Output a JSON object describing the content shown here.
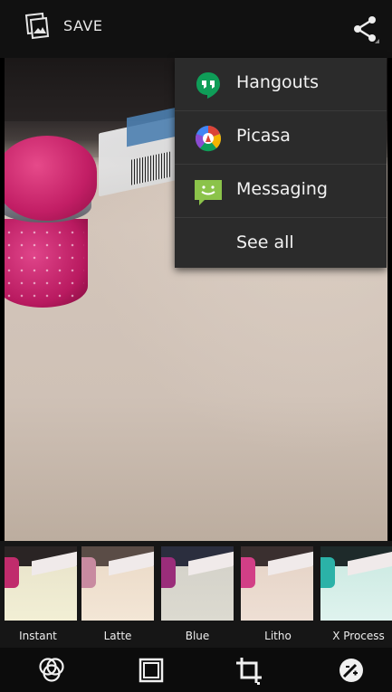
{
  "topbar": {
    "save_label": "SAVE",
    "icons": {
      "save": "photo-frame-icon",
      "share": "share-icon"
    }
  },
  "share_menu": {
    "items": [
      {
        "label": "Hangouts",
        "icon": "hangouts-icon"
      },
      {
        "label": "Picasa",
        "icon": "picasa-icon"
      },
      {
        "label": "Messaging",
        "icon": "messaging-icon"
      },
      {
        "label": "See all"
      }
    ]
  },
  "filters": {
    "items": [
      {
        "label": "Instant"
      },
      {
        "label": "Latte"
      },
      {
        "label": "Blue"
      },
      {
        "label": "Litho"
      },
      {
        "label": "X Process"
      }
    ]
  },
  "toolbar": {
    "tools": [
      {
        "icon": "filters-icon"
      },
      {
        "icon": "border-frame-icon"
      },
      {
        "icon": "crop-icon"
      },
      {
        "icon": "auto-fix-icon"
      }
    ]
  },
  "colors": {
    "hangouts": "#0f9d58",
    "picasa_red": "#db4437",
    "picasa_yellow": "#f4b400",
    "picasa_green": "#0f9d58",
    "picasa_blue": "#4285f4",
    "messaging": "#8bc34a"
  }
}
